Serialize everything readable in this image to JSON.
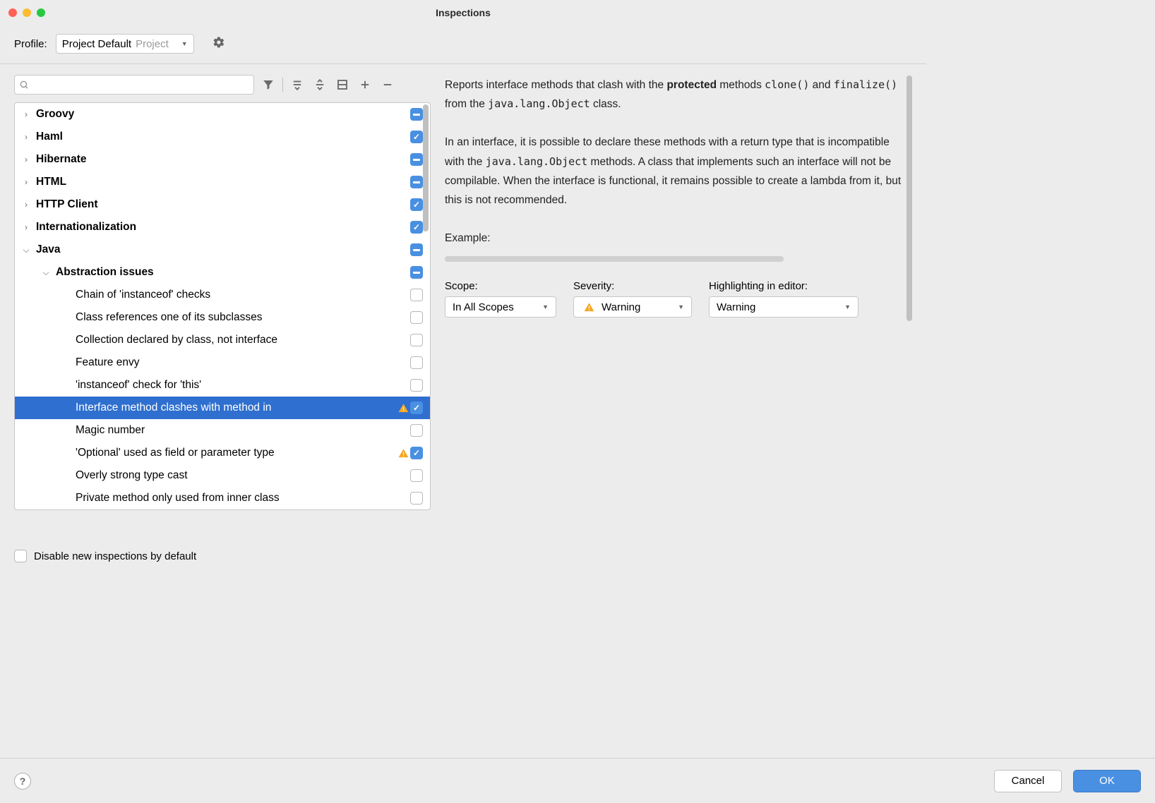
{
  "window": {
    "title": "Inspections"
  },
  "profile": {
    "label": "Profile:",
    "selected": "Project Default",
    "sub": "Project"
  },
  "tree": {
    "items": [
      {
        "label": "Groovy",
        "bold": true,
        "indent": 0,
        "arrow": "closed",
        "state": "mixed"
      },
      {
        "label": "Haml",
        "bold": true,
        "indent": 0,
        "arrow": "closed",
        "state": "checked"
      },
      {
        "label": "Hibernate",
        "bold": true,
        "indent": 0,
        "arrow": "closed",
        "state": "mixed"
      },
      {
        "label": "HTML",
        "bold": true,
        "indent": 0,
        "arrow": "closed",
        "state": "mixed"
      },
      {
        "label": "HTTP Client",
        "bold": true,
        "indent": 0,
        "arrow": "closed",
        "state": "checked"
      },
      {
        "label": "Internationalization",
        "bold": true,
        "indent": 0,
        "arrow": "closed",
        "state": "checked"
      },
      {
        "label": "Java",
        "bold": true,
        "indent": 0,
        "arrow": "open",
        "state": "mixed"
      },
      {
        "label": "Abstraction issues",
        "bold": true,
        "indent": 1,
        "arrow": "open",
        "state": "mixed"
      },
      {
        "label": "Chain of 'instanceof' checks",
        "bold": false,
        "indent": 2,
        "arrow": "none",
        "state": "empty"
      },
      {
        "label": "Class references one of its subclasses",
        "bold": false,
        "indent": 2,
        "arrow": "none",
        "state": "empty"
      },
      {
        "label": "Collection declared by class, not interface",
        "bold": false,
        "indent": 2,
        "arrow": "none",
        "state": "empty"
      },
      {
        "label": "Feature envy",
        "bold": false,
        "indent": 2,
        "arrow": "none",
        "state": "empty"
      },
      {
        "label": "'instanceof' check for 'this'",
        "bold": false,
        "indent": 2,
        "arrow": "none",
        "state": "empty"
      },
      {
        "label": "Interface method clashes with method in",
        "bold": false,
        "indent": 2,
        "arrow": "none",
        "state": "checked",
        "warn": true,
        "selected": true
      },
      {
        "label": "Magic number",
        "bold": false,
        "indent": 2,
        "arrow": "none",
        "state": "empty"
      },
      {
        "label": "'Optional' used as field or parameter type",
        "bold": false,
        "indent": 2,
        "arrow": "none",
        "state": "checked",
        "warn": true
      },
      {
        "label": "Overly strong type cast",
        "bold": false,
        "indent": 2,
        "arrow": "none",
        "state": "empty"
      },
      {
        "label": "Private method only used from inner class",
        "bold": false,
        "indent": 2,
        "arrow": "none",
        "state": "empty"
      }
    ]
  },
  "description": {
    "p1a": "Reports interface methods that clash with the ",
    "p1b": "protected",
    "p1c": " methods ",
    "p1d": "clone()",
    "p1e": " and ",
    "p1f": "finalize()",
    "p1g": " from the ",
    "p1h": "java.lang.Object",
    "p1i": " class.",
    "p2a": "In an interface, it is possible to declare these methods with a return type that is incompatible with the ",
    "p2b": "java.lang.Object",
    "p2c": " methods. A class that implements such an interface will not be compilable. When the interface is functional, it remains possible to create a lambda from it, but this is not recommended.",
    "example_label": "Example:"
  },
  "controls": {
    "scope": {
      "label": "Scope:",
      "value": "In All Scopes"
    },
    "severity": {
      "label": "Severity:",
      "value": "Warning"
    },
    "highlighting": {
      "label": "Highlighting in editor:",
      "value": "Warning"
    }
  },
  "disable_label": "Disable new inspections by default",
  "buttons": {
    "cancel": "Cancel",
    "ok": "OK"
  }
}
